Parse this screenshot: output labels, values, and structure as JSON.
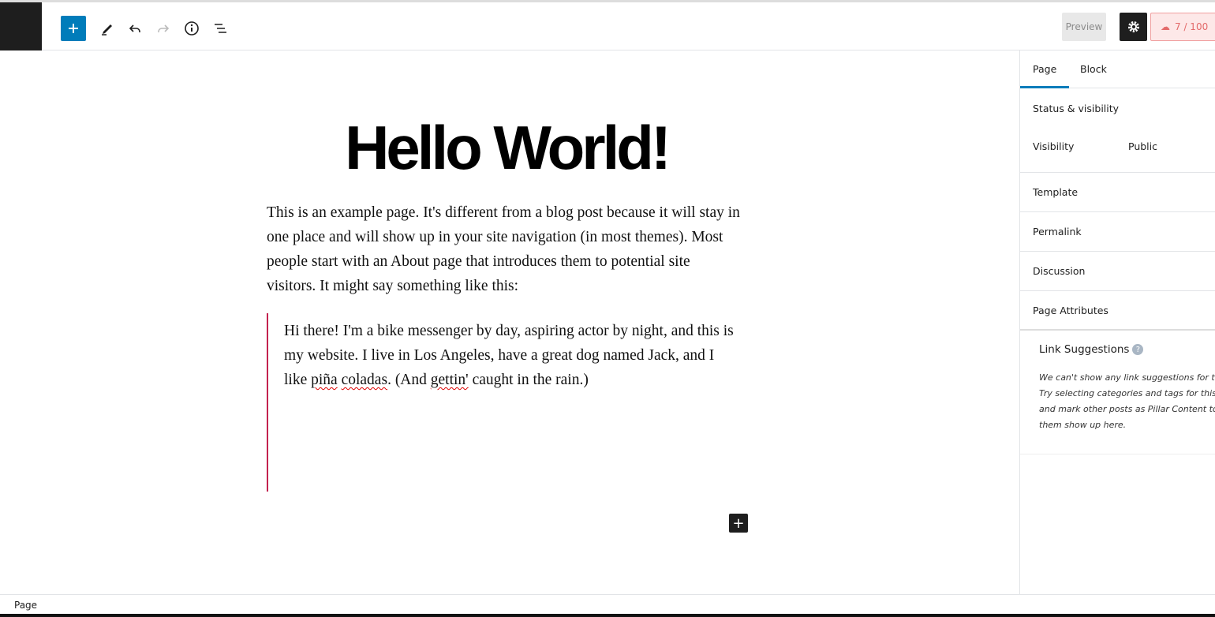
{
  "toolbar": {
    "preview": "Preview",
    "score": "7 / 100",
    "score_color": "#e36a6a",
    "accent": "#007cba"
  },
  "editor": {
    "title": "Hello World!",
    "paragraph": "This is an example page. It's different from a blog post because it will stay in one place and will show up in your site navigation (in most themes). Most people start with an About page that introduces them to potential site visitors. It might say something like this:",
    "quote": {
      "part1": "Hi there! I'm a bike messenger by day, aspiring actor by night, and this is my website. I live in Los Angeles, have a great dog named Jack, and I like ",
      "w1": "piña",
      "w2": "coladas",
      "part2": ". (And ",
      "w3": "gettin'",
      "part3": " caught in the rain.)"
    }
  },
  "sidebar": {
    "tabs": [
      "Page",
      "Block"
    ],
    "status_title": "Status & visibility",
    "visibility_label": "Visibility",
    "visibility_value": "Public",
    "panels": [
      "Template",
      "Permalink",
      "Discussion",
      "Page Attributes"
    ],
    "link_suggestions": {
      "title": "Link Suggestions",
      "lines": [
        "We can't show any link suggestions for this",
        "Try selecting categories and tags for this po",
        "and mark other posts as Pillar Content to m",
        "them show up here."
      ]
    }
  },
  "footer": {
    "breadcrumb": "Page"
  }
}
